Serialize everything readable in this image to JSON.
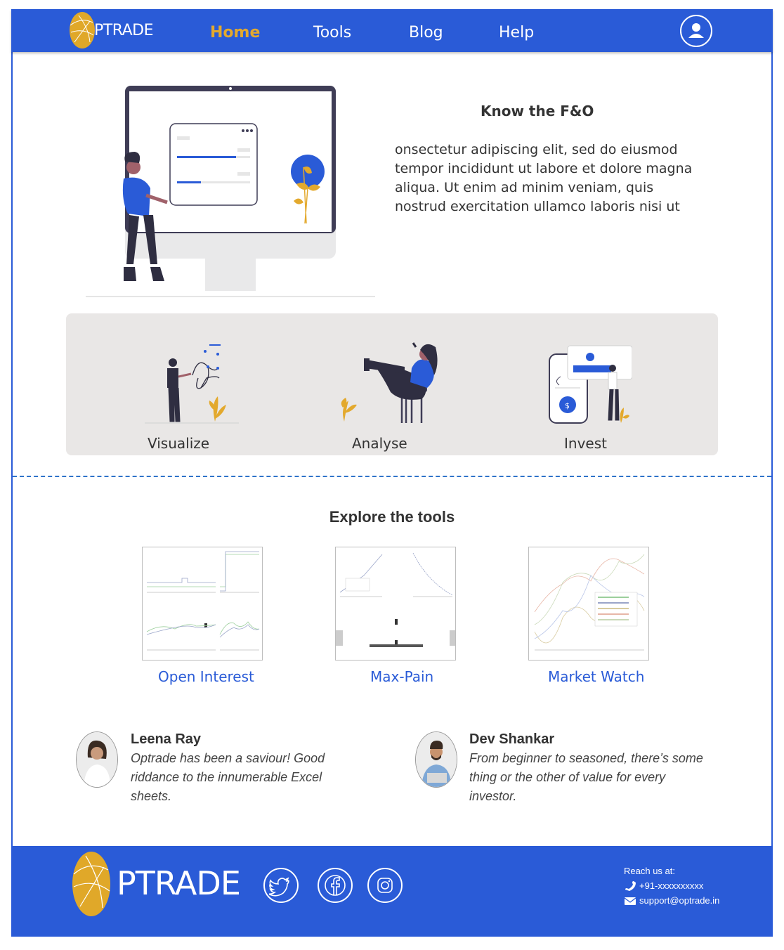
{
  "brand": {
    "logo_text": "PTRADE",
    "primary_color": "#2a5bd7",
    "accent_color": "#e3a92d"
  },
  "nav": {
    "items": [
      {
        "label": "Home",
        "active": true
      },
      {
        "label": "Tools",
        "active": false
      },
      {
        "label": "Blog",
        "active": false
      },
      {
        "label": "Help",
        "active": false
      }
    ],
    "profile_icon": "user-icon"
  },
  "hero": {
    "title": "Know the F&O",
    "body": "onsectetur adipiscing elit, sed do eiusmod tempor incididunt ut labore et dolore magna aliqua. Ut enim ad minim veniam, quis nostrud exercitation ullamco laboris nisi ut"
  },
  "features": [
    {
      "label": "Visualize"
    },
    {
      "label": "Analyse"
    },
    {
      "label": "Invest"
    }
  ],
  "tools": {
    "heading": "Explore the tools",
    "items": [
      {
        "label": "Open Interest"
      },
      {
        "label": "Max-Pain"
      },
      {
        "label": "Market Watch"
      }
    ]
  },
  "testimonials": [
    {
      "name": "Leena Ray",
      "quote": "Optrade has been a saviour! Good riddance to the innumerable Excel sheets."
    },
    {
      "name": "Dev Shankar",
      "quote": "From beginner to seasoned, there’s some thing or the other of value for every investor."
    }
  ],
  "footer": {
    "logo_text": "PTRADE",
    "social_icons": [
      "twitter-icon",
      "facebook-icon",
      "instagram-icon"
    ],
    "reach_label": "Reach us at:",
    "phone": "+91-xxxxxxxxxx",
    "email": "support@optrade.in"
  }
}
